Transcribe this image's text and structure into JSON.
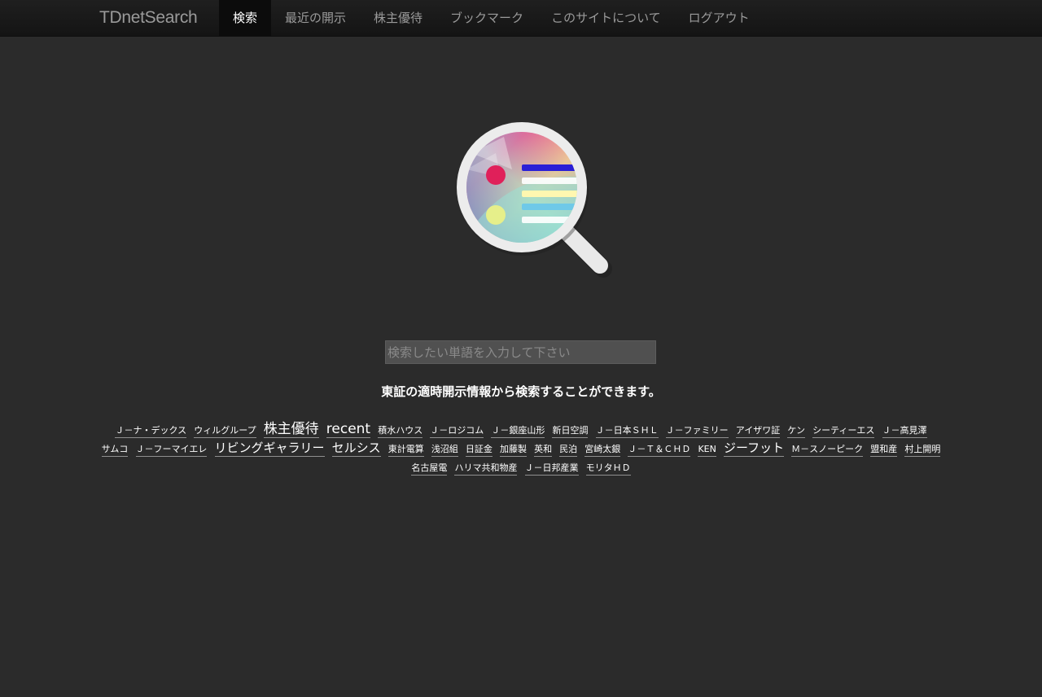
{
  "brand": "TDnetSearch",
  "nav": [
    {
      "label": "検索",
      "active": true
    },
    {
      "label": "最近の開示",
      "active": false
    },
    {
      "label": "株主優待",
      "active": false
    },
    {
      "label": "ブックマーク",
      "active": false
    },
    {
      "label": "このサイトについて",
      "active": false
    },
    {
      "label": "ログアウト",
      "active": false
    }
  ],
  "logo": {
    "icon": "magnifier-logo-icon"
  },
  "search": {
    "placeholder": "検索したい単語を入力して下さい",
    "value": ""
  },
  "tagline": "東証の適時開示情報から検索することができます。",
  "tags": [
    {
      "label": "Ｊ－ナ・デックス",
      "size": 1
    },
    {
      "label": "ウィルグループ",
      "size": 1
    },
    {
      "label": "株主優待",
      "size": 4
    },
    {
      "label": "recent",
      "size": 4
    },
    {
      "label": "積水ハウス",
      "size": 1
    },
    {
      "label": "Ｊ－ロジコム",
      "size": 1
    },
    {
      "label": "Ｊ－銀座山形",
      "size": 1
    },
    {
      "label": "新日空調",
      "size": 1
    },
    {
      "label": "Ｊ－日本ＳＨＬ",
      "size": 1
    },
    {
      "label": "Ｊ－ファミリー",
      "size": 1
    },
    {
      "label": "アイザワ証",
      "size": 1
    },
    {
      "label": "ケン",
      "size": 1
    },
    {
      "label": "シーティーエス",
      "size": 1
    },
    {
      "label": "Ｊ－高見澤",
      "size": 1
    },
    {
      "label": "サムコ",
      "size": 1
    },
    {
      "label": "Ｊ－フーマイエレ",
      "size": 1
    },
    {
      "label": "リビングギャラリー",
      "size": 3
    },
    {
      "label": "セルシス",
      "size": 3
    },
    {
      "label": "東計電算",
      "size": 1
    },
    {
      "label": "浅沼組",
      "size": 1
    },
    {
      "label": "日証金",
      "size": 1
    },
    {
      "label": "加藤製",
      "size": 1
    },
    {
      "label": "英和",
      "size": 1
    },
    {
      "label": "民泊",
      "size": 1
    },
    {
      "label": "宮崎太銀",
      "size": 1
    },
    {
      "label": "Ｊ－Ｔ＆ＣＨＤ",
      "size": 1
    },
    {
      "label": "KEN",
      "size": 1
    },
    {
      "label": "ジーフット",
      "size": 3
    },
    {
      "label": "Ｍ－スノーピーク",
      "size": 1
    },
    {
      "label": "盟和産",
      "size": 1
    },
    {
      "label": "村上開明",
      "size": 1
    },
    {
      "label": "名古屋電",
      "size": 1
    },
    {
      "label": "ハリマ共和物産",
      "size": 1
    },
    {
      "label": "Ｊ－日邦産業",
      "size": 1
    },
    {
      "label": "モリタＨＤ",
      "size": 1
    }
  ]
}
